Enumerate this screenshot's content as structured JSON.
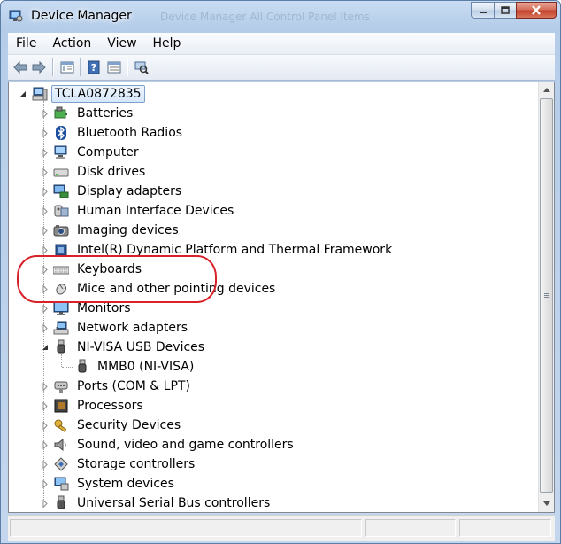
{
  "window": {
    "title": "Device Manager",
    "ghost_title": "Device Manager   All Control Panel Items"
  },
  "menu": [
    "File",
    "Action",
    "View",
    "Help"
  ],
  "toolbar": {
    "icons": [
      "back-icon",
      "forward-icon",
      "show-hide-console-tree-icon",
      "help-icon",
      "properties-icon",
      "scan-hardware-icon"
    ]
  },
  "tree": {
    "root": "TCLA0872835",
    "categories": [
      {
        "label": "Batteries",
        "icon": "battery-icon"
      },
      {
        "label": "Bluetooth Radios",
        "icon": "bluetooth-icon"
      },
      {
        "label": "Computer",
        "icon": "computer-icon"
      },
      {
        "label": "Disk drives",
        "icon": "disk-drive-icon"
      },
      {
        "label": "Display adapters",
        "icon": "display-adapter-icon"
      },
      {
        "label": "Human Interface Devices",
        "icon": "hid-icon"
      },
      {
        "label": "Imaging devices",
        "icon": "camera-icon"
      },
      {
        "label": "Intel(R) Dynamic Platform and Thermal Framework",
        "icon": "chip-icon"
      },
      {
        "label": "Keyboards",
        "icon": "keyboard-icon"
      },
      {
        "label": "Mice and other pointing devices",
        "icon": "mouse-icon"
      },
      {
        "label": "Monitors",
        "icon": "monitor-icon"
      },
      {
        "label": "Network adapters",
        "icon": "network-icon"
      },
      {
        "label": "NI-VISA USB Devices",
        "icon": "usb-plug-icon",
        "expanded": true,
        "children": [
          "MMB0 (NI-VISA)"
        ]
      },
      {
        "label": "Ports (COM & LPT)",
        "icon": "port-icon"
      },
      {
        "label": "Processors",
        "icon": "processor-icon"
      },
      {
        "label": "Security Devices",
        "icon": "key-icon"
      },
      {
        "label": "Sound, video and game controllers",
        "icon": "speaker-icon"
      },
      {
        "label": "Storage controllers",
        "icon": "storage-controller-icon"
      },
      {
        "label": "System devices",
        "icon": "system-device-icon"
      },
      {
        "label": "Universal Serial Bus controllers",
        "icon": "usb-plug-icon"
      }
    ]
  },
  "colors": {
    "highlight": "#d8222a",
    "selection_border": "#7da2ce"
  }
}
